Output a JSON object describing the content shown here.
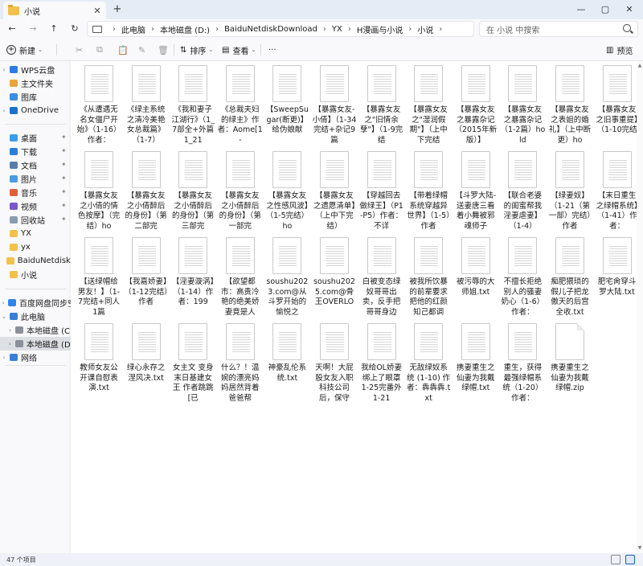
{
  "tab": {
    "title": "小说",
    "close_symbol": "✕",
    "new_tab_symbol": "+"
  },
  "window_controls": {
    "minimize": "—",
    "maximize": "▢",
    "close": "✕"
  },
  "nav": {
    "back": "←",
    "forward": "→",
    "up": "↑",
    "refresh": "↻"
  },
  "breadcrumbs": [
    "此电脑",
    "本地磁盘 (D:)",
    "BaiduNetdiskDownload",
    "YX",
    "H漫画与小说",
    "小说"
  ],
  "search": {
    "placeholder": "在 小说 中搜索"
  },
  "toolbar": {
    "new_label": "新建",
    "sort_label": "排序",
    "view_label": "查看",
    "more_label": "···",
    "preview_label": "预览",
    "cut_icon": "✂",
    "copy_icon": "⧉",
    "paste_icon": "📋",
    "rename_icon": "✎",
    "share_icon": "⇪",
    "delete_icon": "🗑"
  },
  "sidebar": {
    "items": [
      {
        "label": "WPS云盘",
        "icon": "wps-cloud-icon",
        "color": "#2f7ae5",
        "expandable": true,
        "pinned": false
      },
      {
        "label": "主文件夹",
        "icon": "home-icon",
        "color": "#e8a33d",
        "expandable": false,
        "pinned": false
      },
      {
        "label": "图库",
        "icon": "gallery-icon",
        "color": "#3a8de0",
        "expandable": false,
        "pinned": false
      },
      {
        "label": "OneDrive",
        "icon": "onedrive-icon",
        "color": "#1a73c9",
        "expandable": true,
        "pinned": false
      },
      {
        "label": "桌面",
        "icon": "desktop-icon",
        "color": "#3a9de8",
        "expandable": false,
        "pinned": true
      },
      {
        "label": "下载",
        "icon": "download-icon",
        "color": "#2b7fd6",
        "expandable": false,
        "pinned": true
      },
      {
        "label": "文档",
        "icon": "documents-icon",
        "color": "#5a7ea8",
        "expandable": false,
        "pinned": true
      },
      {
        "label": "图片",
        "icon": "pictures-icon",
        "color": "#4a9be0",
        "expandable": false,
        "pinned": true
      },
      {
        "label": "音乐",
        "icon": "music-icon",
        "color": "#e0603a",
        "expandable": false,
        "pinned": true
      },
      {
        "label": "视频",
        "icon": "videos-icon",
        "color": "#7a58c8",
        "expandable": false,
        "pinned": true
      },
      {
        "label": "回收站",
        "icon": "recycle-bin-icon",
        "color": "#8a9bb0",
        "expandable": false,
        "pinned": true
      },
      {
        "label": "YX",
        "icon": "folder-icon",
        "color": "#f2c14b",
        "expandable": false,
        "pinned": false
      },
      {
        "label": "yx",
        "icon": "folder-icon",
        "color": "#f2c14b",
        "expandable": false,
        "pinned": false
      },
      {
        "label": "BaiduNetdiskDownload",
        "icon": "folder-icon",
        "color": "#f2c14b",
        "expandable": false,
        "pinned": false
      },
      {
        "label": "小说",
        "icon": "folder-icon",
        "color": "#f2c14b",
        "expandable": false,
        "pinned": false
      },
      {
        "label": "百度网盘同步空间",
        "icon": "baidu-netdisk-icon",
        "color": "#2e86e8",
        "expandable": true,
        "pinned": false
      },
      {
        "label": "此电脑",
        "icon": "this-pc-icon",
        "color": "#3a7fd6",
        "expandable": true,
        "pinned": false,
        "expanded": true
      },
      {
        "label": "本地磁盘 (C:)",
        "icon": "drive-icon",
        "color": "#8a8f98",
        "expandable": true,
        "pinned": false
      },
      {
        "label": "本地磁盘 (D:)",
        "icon": "drive-icon",
        "color": "#8a8f98",
        "expandable": true,
        "pinned": false,
        "selected": true
      },
      {
        "label": "网络",
        "icon": "network-icon",
        "color": "#3a7fd6",
        "expandable": true,
        "pinned": false
      }
    ]
  },
  "files": [
    "《从遭遇无名女僵尸开始》（1-16）作者：",
    "《绿主系统之清冷美艳女总裁篇》（1-7）",
    "《我和妻子江湖行》（1_7部全+外篇1_21",
    "《总裁夫妇的绿主》作者：Aome[1-",
    "【SweepSugar(断更)】给伪娘献",
    "【暴露女友-小倩】（1-34完结+杂记9篇",
    "【暴露女友之\"旧情余孽\"】（1-9完结",
    "【暴露女友之\"湿润假期\"】（上中下完结",
    "【暴露女友之暴露杂记（2015年新版）】",
    "【暴露女友之暴露杂记（1-2篇）hold",
    "【暴露女友之表姐的婚礼】（上中断更）ho",
    "【暴露女友之旧事重提】（1-10完结",
    "【暴露女友之小倩的情色按摩】（完结）ho",
    "【暴露女友之小倩醉后的身份】（第二部完",
    "【暴露女友之小倩醉后的身份】（第三部完",
    "【暴露女友之小倩醉后的身份】（第一部完",
    "【暴露女友之性感风波】（1-5完结）ho",
    "【暴露女友之遗愿清单】（上中下完结）",
    "【穿越回去做绿王】（P1-P5）作者：不详",
    "【带着绿帽系统穿越异世界】（1-5）作者",
    "【斗罗大陆-送妻唐三看着小舞被邪魂师子",
    "【联合老婆的闺蜜帮我淫妻虐妻】（1-4）",
    "【绿妻奴】（1-21（第一部）完结）作者",
    "【末日重生之绿帽系统】（1-41）作者：",
    "【送绿帽给男友！】（1-7完结+同人1篇",
    "【我嘉娇妻】（1-12完结）作者",
    "【淫妻漩涡】（1-14）作者：199",
    "【欲望都市：高贵冷艳的绝美娇妻竟是人",
    "soushu2023.com@从斗罗开始的愉悦之",
    "soushu2025.com@骨王OVERLO",
    "白被变态绿奴哥哥出卖，反手把哥哥身边",
    "被我所饮暴的前辈要求把他的红颜知己都调",
    "被污辱的大师姐.txt",
    "不擅长拒绝别人的骚妻奶心（1-6）作者：",
    "痴肥猥琐的假儿子把龙傲天的后宫全收.txt",
    "肥宅肏穿斗罗大陆.txt",
    "教师女友公开课自慰表演.txt",
    "绿心永存之涅风决.txt",
    "女主文 变身末日基建女王 作者跳跳 [已",
    "什么？！温婉的漂亮妈妈居然背着爸爸帮",
    "神豪乱伦系统.txt",
    "天啊！大屁股女友入职科技公司后，保守",
    "我给OL娇妻绑上了眼罩 1-25完番外1-21",
    "无敌绿奴系统 (1-10) 作者：犇犇犇.txt",
    "携妻重生之仙妻为我戴绿帽.txt",
    "重生，获得最强绿帽系统（1-20）作者：",
    "携妻重生之仙妻为我戴绿帽.zip"
  ],
  "file_types": [
    "txt",
    "txt",
    "txt",
    "txt",
    "txt",
    "txt",
    "txt",
    "txt",
    "txt",
    "txt",
    "txt",
    "txt",
    "txt",
    "txt",
    "txt",
    "txt",
    "txt",
    "txt",
    "txt",
    "txt",
    "txt",
    "txt",
    "txt",
    "txt",
    "txt",
    "txt",
    "txt",
    "txt",
    "txt",
    "txt",
    "txt",
    "txt",
    "txt",
    "txt",
    "txt",
    "txt",
    "txt",
    "txt",
    "txt",
    "txt",
    "txt",
    "txt",
    "txt",
    "txt",
    "txt",
    "txt",
    "zip"
  ],
  "status": {
    "count": "47 个项目"
  },
  "colors": {
    "accent": "#1a5fb4",
    "folder": "#f2c14b",
    "selected_bg": "#dcdfe4"
  }
}
